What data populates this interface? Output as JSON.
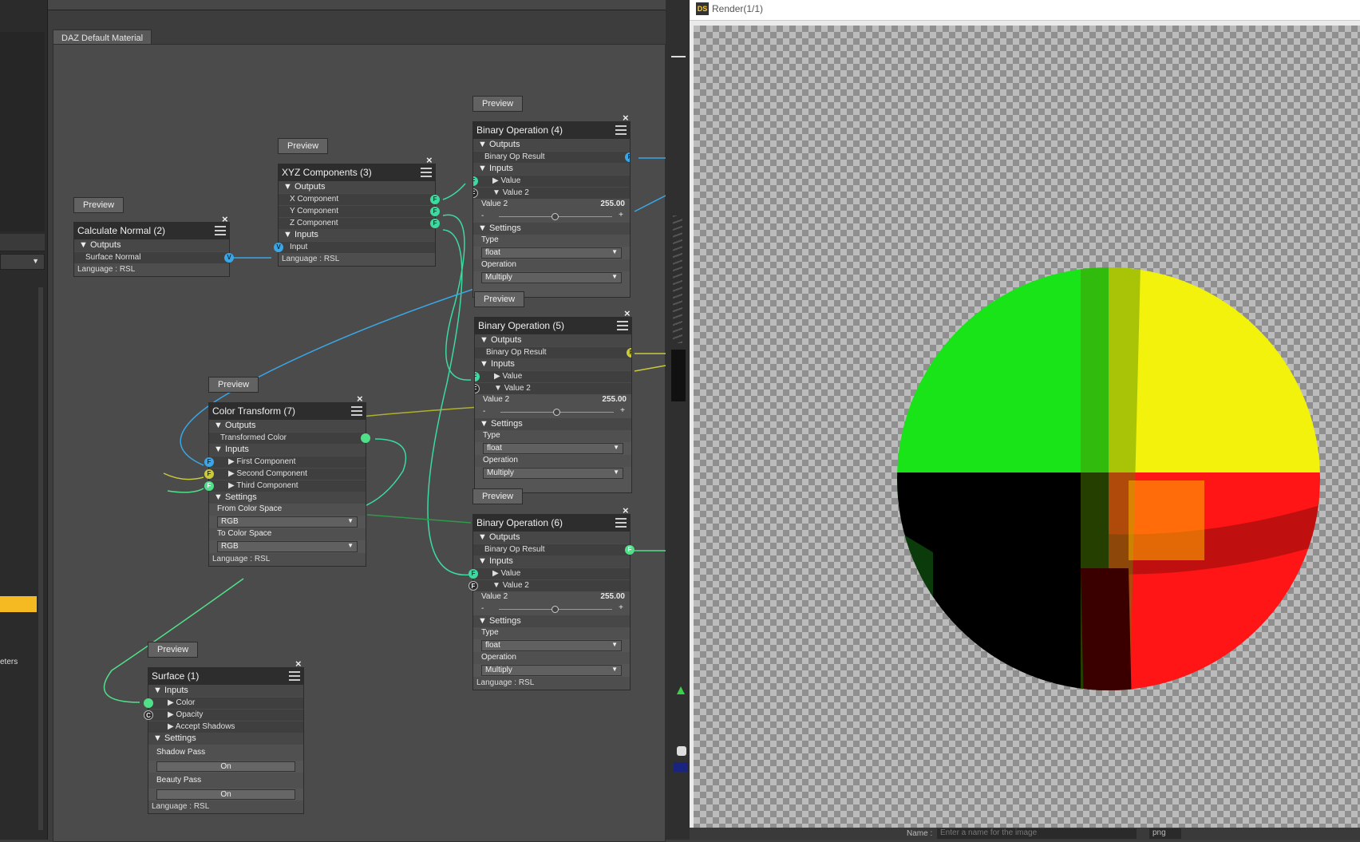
{
  "tab_label": "DAZ Default Material",
  "render_window": {
    "title": "Render(1/1)",
    "app_badge": "DS",
    "name_label": "Name :",
    "name_placeholder": "Enter a name for the image",
    "format": "png"
  },
  "left_panel": {
    "partial_text": "eters"
  },
  "preview_label": "Preview",
  "nodes": {
    "calc_normal": {
      "title": "Calculate Normal (2)",
      "outputs": "Outputs",
      "surface_normal": "Surface Normal",
      "language": "Language : RSL"
    },
    "xyz": {
      "title": "XYZ Components (3)",
      "outputs": "Outputs",
      "x": "X Component",
      "y": "Y Component",
      "z": "Z Component",
      "inputs": "Inputs",
      "input": "Input",
      "language": "Language : RSL"
    },
    "bin4": {
      "title": "Binary Operation (4)",
      "outputs": "Outputs",
      "result": "Binary Op Result",
      "inputs": "Inputs",
      "value": "Value",
      "value2": "Value 2",
      "value2_label": "Value 2",
      "value2_num": "255.00",
      "settings": "Settings",
      "type_label": "Type",
      "type_val": "float",
      "op_label": "Operation",
      "op_val": "Multiply"
    },
    "bin5": {
      "title": "Binary Operation (5)",
      "outputs": "Outputs",
      "result": "Binary Op Result",
      "inputs": "Inputs",
      "value": "Value",
      "value2": "Value 2",
      "value2_label": "Value 2",
      "value2_num": "255.00",
      "settings": "Settings",
      "type_label": "Type",
      "type_val": "float",
      "op_label": "Operation",
      "op_val": "Multiply"
    },
    "bin6": {
      "title": "Binary Operation (6)",
      "outputs": "Outputs",
      "result": "Binary Op Result",
      "inputs": "Inputs",
      "value": "Value",
      "value2": "Value 2",
      "value2_label": "Value 2",
      "value2_num": "255.00",
      "settings": "Settings",
      "type_label": "Type",
      "type_val": "float",
      "op_label": "Operation",
      "op_val": "Multiply",
      "language": "Language : RSL"
    },
    "color_transform": {
      "title": "Color Transform (7)",
      "outputs": "Outputs",
      "transformed": "Transformed Color",
      "inputs": "Inputs",
      "first": "First Component",
      "second": "Second Component",
      "third": "Third Component",
      "settings": "Settings",
      "from_label": "From Color Space",
      "from_val": "RGB",
      "to_label": "To Color Space",
      "to_val": "RGB",
      "language": "Language : RSL"
    },
    "surface": {
      "title": "Surface (1)",
      "inputs": "Inputs",
      "color": "Color",
      "opacity": "Opacity",
      "accept_shadows": "Accept Shadows",
      "settings": "Settings",
      "shadow_pass": "Shadow Pass",
      "shadow_val": "On",
      "beauty_pass": "Beauty Pass",
      "beauty_val": "On",
      "language": "Language : RSL"
    }
  },
  "port_letters": {
    "F": "F",
    "V": "V",
    "C": "C"
  }
}
